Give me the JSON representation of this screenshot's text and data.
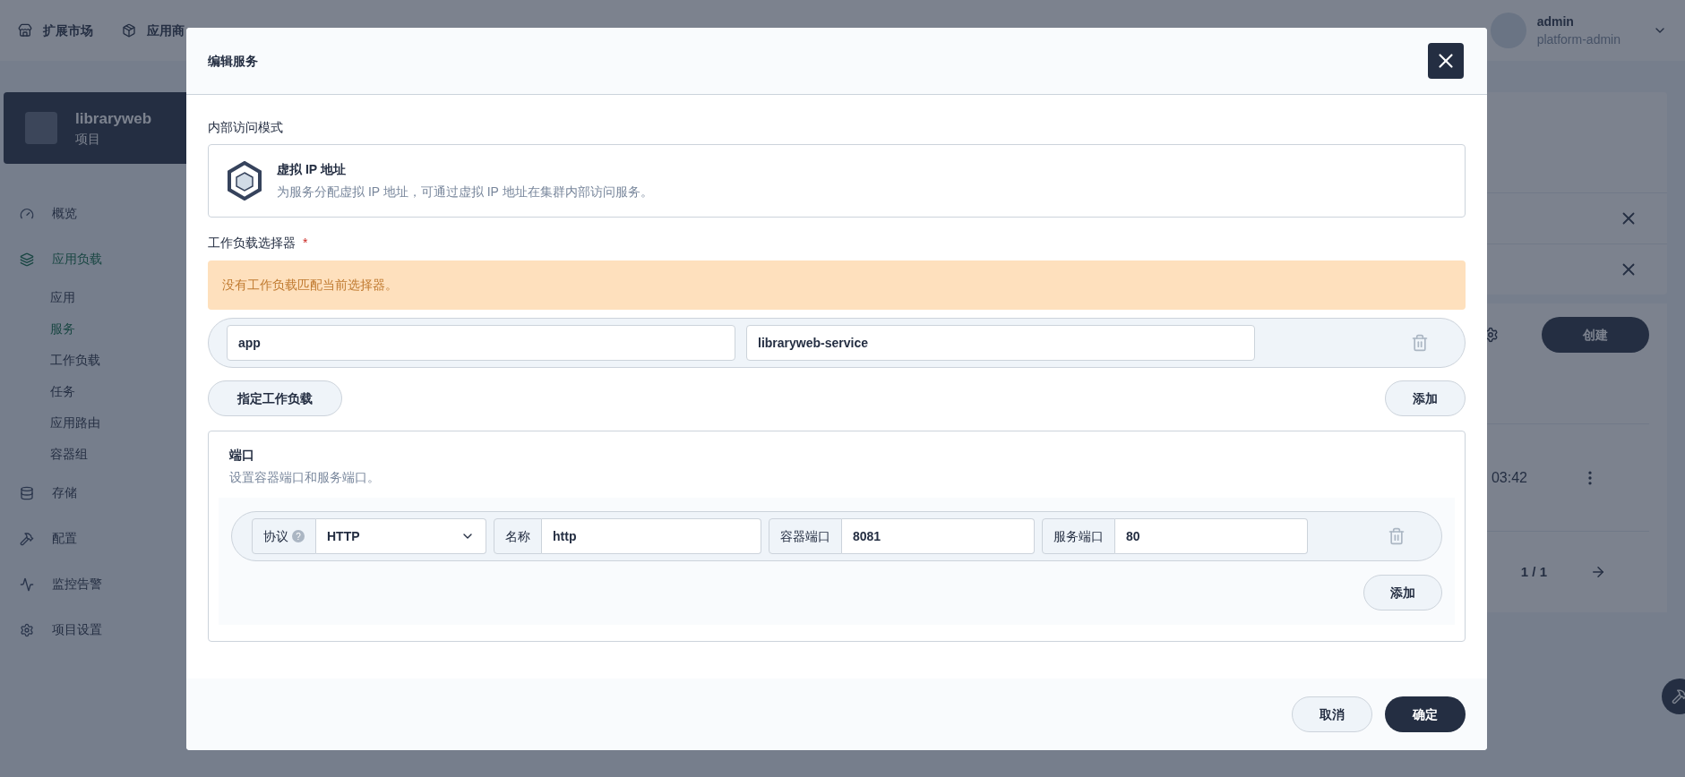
{
  "top_nav": {
    "items": [
      {
        "label": "扩展市场"
      },
      {
        "label": "应用商"
      }
    ],
    "user": {
      "name": "admin",
      "role": "platform-admin"
    }
  },
  "sidebar": {
    "project": {
      "name": "libraryweb",
      "type": "项目"
    },
    "items": [
      {
        "label": "概览",
        "selected": false
      },
      {
        "label": "应用负载",
        "selected": true,
        "children": [
          {
            "label": "应用",
            "selected": false
          },
          {
            "label": "服务",
            "selected": true
          },
          {
            "label": "工作负载",
            "selected": false
          },
          {
            "label": "任务",
            "selected": false
          },
          {
            "label": "应用路由",
            "selected": false
          },
          {
            "label": "容器组",
            "selected": false
          }
        ]
      },
      {
        "label": "存储",
        "selected": false
      },
      {
        "label": "配置",
        "selected": false
      },
      {
        "label": "监控告警",
        "selected": false
      },
      {
        "label": "项目设置",
        "selected": false
      }
    ]
  },
  "main": {
    "create_button": "创建",
    "table_rows": [
      {
        "time": "03:42"
      }
    ],
    "pagination": "1 / 1"
  },
  "dialog": {
    "title": "编辑服务",
    "access_mode": {
      "label": "内部访问模式",
      "title": "虚拟 IP 地址",
      "description": "为服务分配虚拟 IP 地址，可通过虚拟 IP 地址在集群内部访问服务。"
    },
    "selector": {
      "label": "工作负载选择器",
      "required_mark": "*",
      "warning": "没有工作负载匹配当前选择器。",
      "rows": [
        {
          "key": "app",
          "value": "libraryweb-service"
        }
      ],
      "specify_button": "指定工作负载",
      "add_button": "添加"
    },
    "ports": {
      "title": "端口",
      "description": "设置容器端口和服务端口。",
      "rows": [
        {
          "protocol_label": "协议",
          "help_mark": "?",
          "protocol": "HTTP",
          "name_label": "名称",
          "name": "http",
          "container_port_label": "容器端口",
          "container_port": "8081",
          "service_port_label": "服务端口",
          "service_port": "80"
        }
      ],
      "add_button": "添加"
    },
    "cancel_button": "取消",
    "confirm_button": "确定"
  }
}
